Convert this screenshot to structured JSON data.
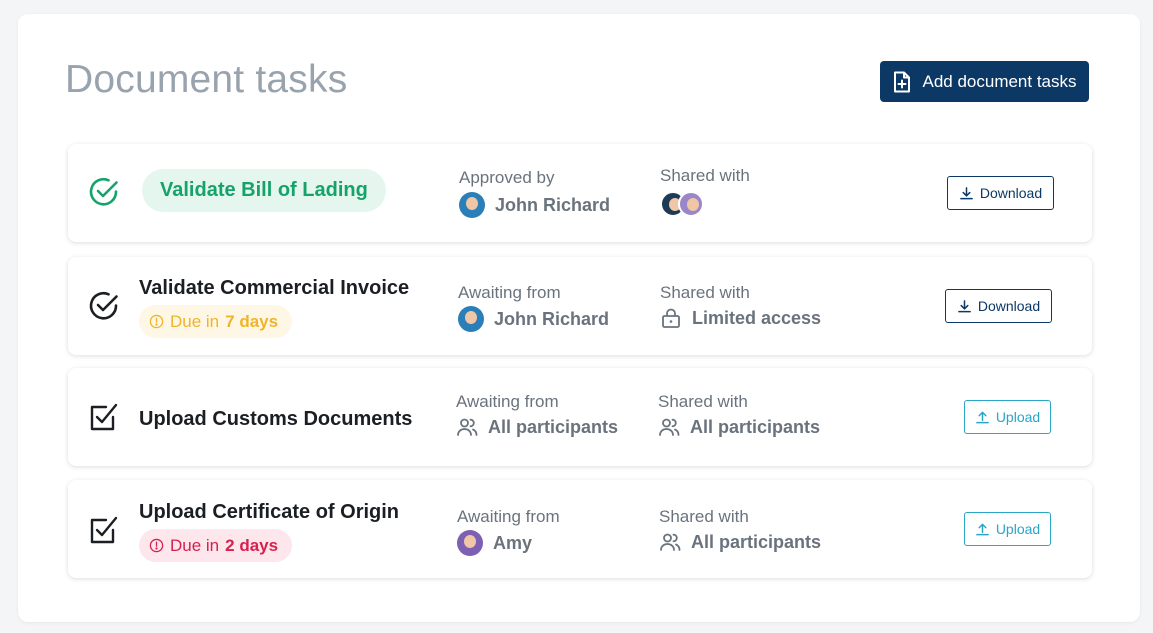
{
  "page": {
    "title": "Document tasks"
  },
  "header": {
    "add_button_label": "Add document tasks",
    "add_icon": "file-plus-icon"
  },
  "colors": {
    "primary": "#0c3866",
    "success": "#16a36a",
    "success_bg": "#e4f6ee",
    "warning": "#f0b429",
    "danger": "#d8204f",
    "upload": "#2aa6c7",
    "muted": "#6a737d"
  },
  "tasks": [
    {
      "title": "Validate Bill of Lading",
      "status_icon": "check-circle-icon",
      "person_label": "Approved by",
      "person_name": "John Richard",
      "shared_label": "Shared with",
      "action_label": "Download",
      "action_icon": "download-icon"
    },
    {
      "title": "Validate Commercial Invoice",
      "status_icon": "check-circle-icon",
      "due_prefix": "Due in",
      "due_value": "7 days",
      "person_label": "Awaiting from",
      "person_name": "John Richard",
      "shared_label": "Shared with",
      "shared_value": "Limited access",
      "shared_icon": "lock-icon",
      "action_label": "Download",
      "action_icon": "download-icon"
    },
    {
      "title": "Upload Customs Documents",
      "status_icon": "checkbox-pen-icon",
      "person_label": "Awaiting from",
      "person_name": "All participants",
      "person_icon": "users-icon",
      "shared_label": "Shared with",
      "shared_value": "All participants",
      "shared_icon": "users-icon",
      "action_label": "Upload",
      "action_icon": "upload-icon"
    },
    {
      "title": "Upload Certificate of Origin",
      "status_icon": "checkbox-pen-icon",
      "due_prefix": "Due in",
      "due_value": "2 days",
      "person_label": "Awaiting from",
      "person_name": "Amy",
      "shared_label": "Shared with",
      "shared_value": "All participants",
      "shared_icon": "users-icon",
      "action_label": "Upload",
      "action_icon": "upload-icon"
    }
  ]
}
